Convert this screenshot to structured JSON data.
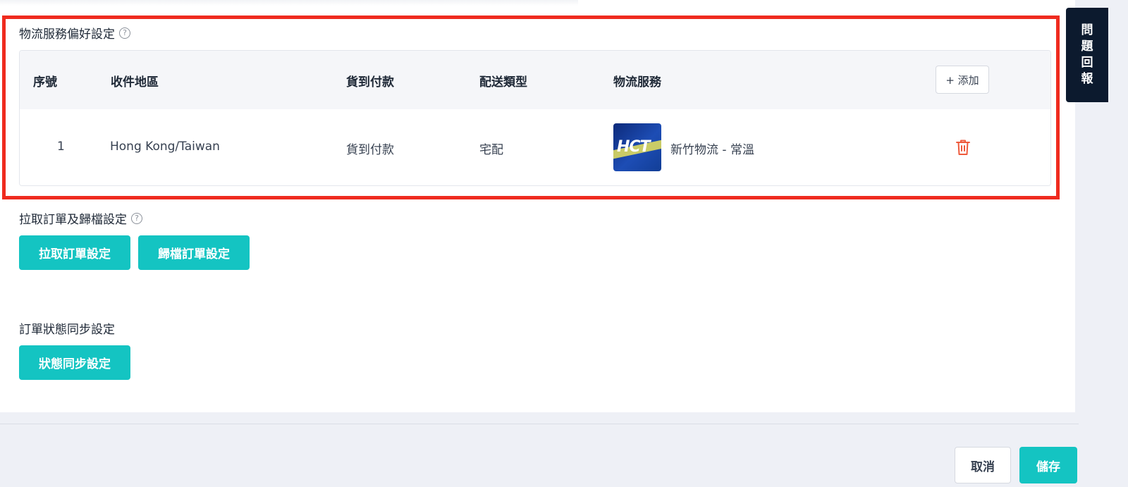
{
  "logistics_section": {
    "title": "物流服務偏好設定",
    "help_glyph": "?",
    "table": {
      "columns": [
        "序號",
        "收件地區",
        "貨到付款",
        "配送類型",
        "物流服務"
      ],
      "add_button_label": "+ 添加",
      "rows": [
        {
          "index": "1",
          "region": "Hong Kong/Taiwan",
          "cod": "貨到付款",
          "delivery_type": "宅配",
          "logo_text": "HCT",
          "service": "新竹物流 - 常溫",
          "action_icon": "trash-icon"
        }
      ]
    }
  },
  "order_section": {
    "title": "拉取訂單及歸檔設定",
    "help_glyph": "?",
    "pull_button_label": "拉取訂單設定",
    "archive_button_label": "歸檔訂單設定"
  },
  "sync_section": {
    "title": "訂單狀態同步設定",
    "sync_button_label": "狀態同步設定"
  },
  "footer": {
    "cancel_label": "取消",
    "save_label": "儲存"
  },
  "feedback_tab": {
    "chars": [
      "問",
      "題",
      "回",
      "報"
    ]
  },
  "colors": {
    "accent": "#14c4c2",
    "highlight_frame": "#ef2b1f",
    "danger_icon": "#ee5a3c",
    "feedback_bg": "#0c1a2e"
  }
}
